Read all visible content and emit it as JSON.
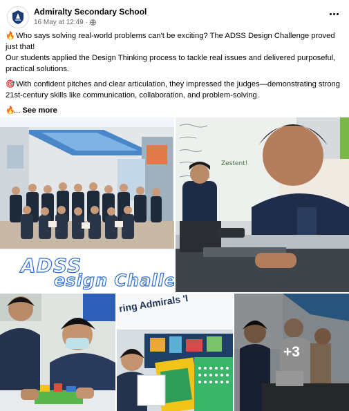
{
  "header": {
    "page_name": "Admiralty Secondary School",
    "timestamp": "16 May at 12:49",
    "separator": "·",
    "privacy_icon": "globe-icon",
    "more_icon": "more-options-icon"
  },
  "post": {
    "paragraph_1_line_1": "Who says solving real-world problems can't be exciting? The ADSS Design Challenge proved",
    "paragraph_1_line_2": "just that!",
    "paragraph_1_line_3": "Our students applied the Design Thinking process to tackle real issues and delivered purposeful,",
    "paragraph_1_line_4": "practical solutions.",
    "paragraph_2_line_1": "With confident pitches and clear articulation, they impressed the judges—demonstrating strong",
    "paragraph_2_line_2": "21st-century skills like communication, collaboration, and problem-solving.",
    "ellipsis": "...",
    "see_more": "See more",
    "emoji_fire": "🔥",
    "emoji_target": "🎯"
  },
  "gallery": {
    "tile_1_caption_line_1": "ADSS",
    "tile_1_caption_line_2": "esign Challenge",
    "tile_2_whiteboard_text": "Zestent!",
    "tile_4_banner_text": "ring Admirals 'I",
    "more_count": "+3"
  },
  "colors": {
    "accent_blue": "#2d6fd0",
    "meta_gray": "#65676b",
    "text": "#050505"
  }
}
